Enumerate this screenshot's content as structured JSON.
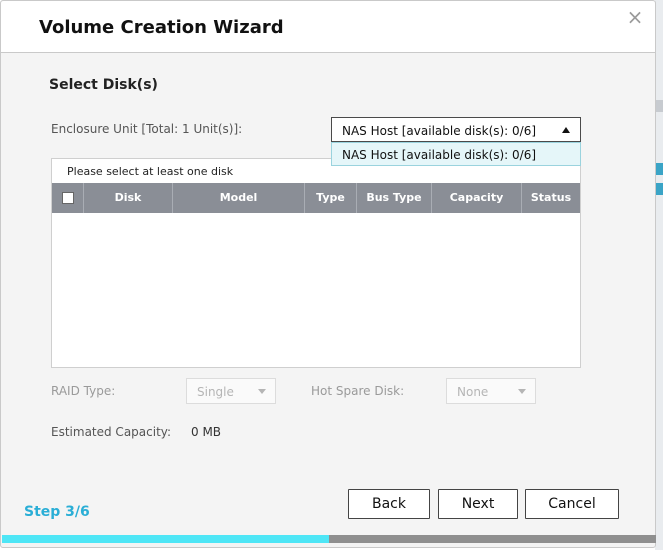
{
  "dialog": {
    "title": "Volume Creation Wizard",
    "close_glyph": "×"
  },
  "section": {
    "title": "Select Disk(s)"
  },
  "enclosure": {
    "label": "Enclosure Unit [Total: 1 Unit(s)]:",
    "selected": "NAS Host [available disk(s): 0/6]",
    "options": [
      "NAS Host [available disk(s): 0/6]"
    ]
  },
  "disk_table": {
    "hint": "Please select at least one disk",
    "columns": [
      "Disk",
      "Model",
      "Type",
      "Bus Type",
      "Capacity",
      "Status"
    ],
    "rows": []
  },
  "raid": {
    "label": "RAID Type:",
    "value": "Single"
  },
  "hot_spare": {
    "label": "Hot Spare Disk:",
    "value": "None"
  },
  "capacity": {
    "label": "Estimated Capacity:",
    "value": "0 MB"
  },
  "footer": {
    "step": "Step 3/6",
    "back_label": "Back",
    "next_label": "Next",
    "cancel_label": "Cancel"
  },
  "progress": {
    "fraction": 0.5
  },
  "colors": {
    "accent": "#2aaed6",
    "progress_fill": "#4ee6f6",
    "table_header": "#8a8e96"
  }
}
